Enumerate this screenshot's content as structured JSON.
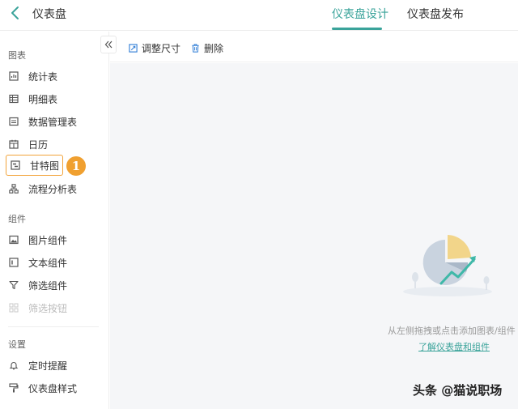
{
  "header": {
    "title": "仪表盘",
    "tabs": [
      {
        "label": "仪表盘设计",
        "active": true
      },
      {
        "label": "仪表盘发布",
        "active": false
      }
    ]
  },
  "toolbar": {
    "resize_label": "调整尺寸",
    "delete_label": "删除"
  },
  "sidebar": {
    "collapse_icon": "double-chevron-left-icon",
    "sections": [
      {
        "title": "图表",
        "items": [
          {
            "label": "统计表",
            "icon": "stat-table-icon"
          },
          {
            "label": "明细表",
            "icon": "detail-table-icon"
          },
          {
            "label": "数据管理表",
            "icon": "data-manage-icon"
          },
          {
            "label": "日历",
            "icon": "calendar-icon"
          },
          {
            "label": "甘特图",
            "icon": "gantt-icon",
            "selected": true
          },
          {
            "label": "流程分析表",
            "icon": "flow-icon"
          }
        ]
      },
      {
        "title": "组件",
        "items": [
          {
            "label": "图片组件",
            "icon": "image-icon"
          },
          {
            "label": "文本组件",
            "icon": "text-icon"
          },
          {
            "label": "筛选组件",
            "icon": "filter-icon"
          },
          {
            "label": "筛选按钮",
            "icon": "filter-button-icon",
            "disabled": true
          }
        ]
      },
      {
        "title": "设置",
        "items": [
          {
            "label": "定时提醒",
            "icon": "bell-icon"
          },
          {
            "label": "仪表盘样式",
            "icon": "paint-roller-icon"
          }
        ]
      }
    ]
  },
  "step_badge": "1",
  "empty_state": {
    "text": "从左侧拖拽或点击添加图表/组件",
    "link": "了解仪表盘和组件"
  },
  "watermark": "头条 @猫说职场",
  "colors": {
    "accent": "#3aa39a",
    "highlight_border": "#f2a33a",
    "badge": "#f0a030",
    "canvas_bg": "#f5f6f8"
  }
}
